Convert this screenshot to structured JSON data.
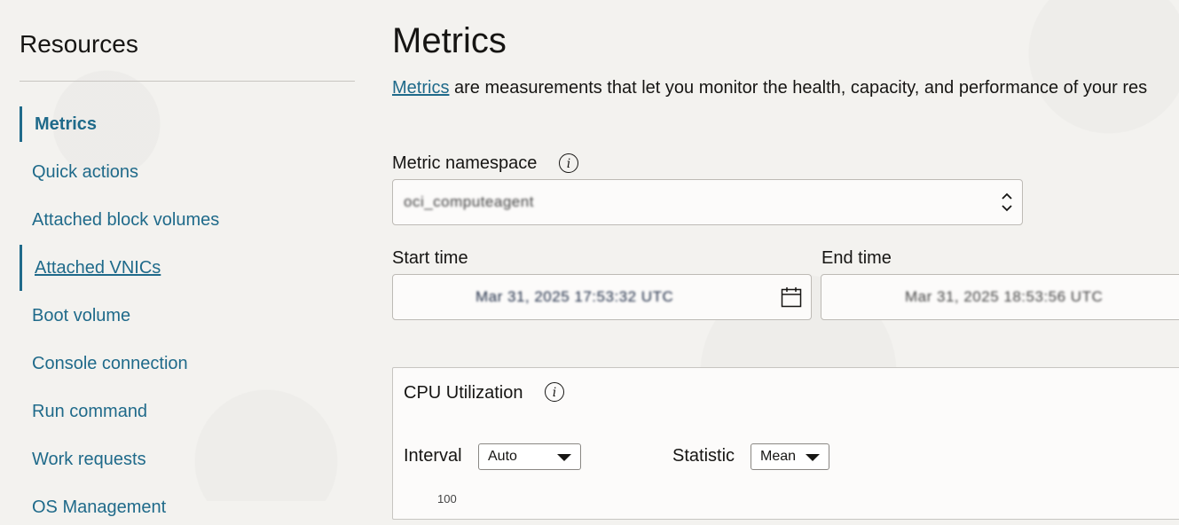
{
  "sidebar": {
    "title": "Resources",
    "items": [
      {
        "label": "Metrics"
      },
      {
        "label": "Quick actions"
      },
      {
        "label": "Attached block volumes"
      },
      {
        "label": "Attached VNICs"
      },
      {
        "label": "Boot volume"
      },
      {
        "label": "Console connection"
      },
      {
        "label": "Run command"
      },
      {
        "label": "Work requests"
      },
      {
        "label": "OS Management"
      }
    ]
  },
  "main": {
    "title": "Metrics",
    "desc_link": "Metrics",
    "desc_text": " are measurements that let you monitor the health, capacity, and performance of your res",
    "namespace": {
      "label": "Metric namespace",
      "value": "oci_computeagent"
    },
    "start_time": {
      "label": "Start time",
      "value": "Mar 31, 2025 17:53:32 UTC"
    },
    "end_time": {
      "label": "End time",
      "value": "Mar 31, 2025 18:53:56 UTC"
    },
    "chart_panel": {
      "title": "CPU Utilization",
      "interval_label": "Interval",
      "interval_value": "Auto",
      "statistic_label": "Statistic",
      "statistic_value": "Mean",
      "y_tick_top": "100"
    }
  },
  "colors": {
    "link": "#1f6a8a",
    "background": "#f3f2ef"
  },
  "icons": [
    "info-icon",
    "chevron-updown-icon",
    "calendar-icon",
    "dropdown-triangle-icon"
  ]
}
